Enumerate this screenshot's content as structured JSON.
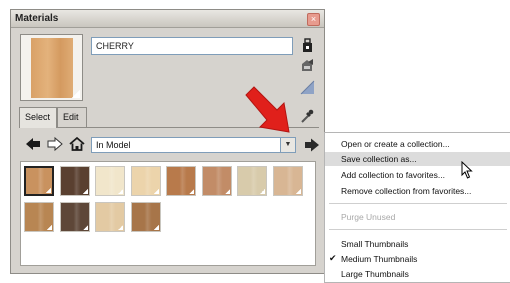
{
  "panel": {
    "title": "Materials",
    "close_glyph": "×",
    "material_name": "CHERRY",
    "tabs": [
      {
        "label": "Select"
      },
      {
        "label": "Edit"
      }
    ],
    "collection": "In Model",
    "dropdown_glyph": "▼"
  },
  "icons": {
    "bucket": "paint-bucket-icon",
    "create": "create-material-icon",
    "default": "default-material-icon",
    "sample": "sample-paint-icon",
    "back": "back-arrow-icon",
    "forward": "forward-arrow-icon",
    "home": "home-icon",
    "details": "details-arrow-icon"
  },
  "swatches": [
    {
      "color": "#c9925f",
      "selected": true
    },
    {
      "color": "#5a4030"
    },
    {
      "color": "#f1e6cb"
    },
    {
      "color": "#ecd4ab"
    },
    {
      "color": "#b87a4b"
    },
    {
      "color": "#c28c67"
    },
    {
      "color": "#d8cbab"
    },
    {
      "color": "#d8b694"
    },
    {
      "color": "#b88653"
    },
    {
      "color": "#5e4738"
    },
    {
      "color": "#e3caa3"
    },
    {
      "color": "#a77549"
    }
  ],
  "menu": {
    "items": [
      {
        "label": "Open or create a collection..."
      },
      {
        "label": "Save collection as...",
        "highlight": true
      },
      {
        "label": "Add collection to favorites..."
      },
      {
        "label": "Remove collection from favorites..."
      },
      {
        "label": "Purge Unused",
        "disabled": true
      },
      {
        "label": "Small Thumbnails"
      },
      {
        "label": "Medium Thumbnails",
        "checked": true
      },
      {
        "label": "Large Thumbnails"
      }
    ],
    "check_glyph": "✔"
  },
  "colors": {
    "panel_bg": "#d6d3ce",
    "arrow_red": "#e0201b",
    "menu_highlight": "#dcdcdc"
  }
}
